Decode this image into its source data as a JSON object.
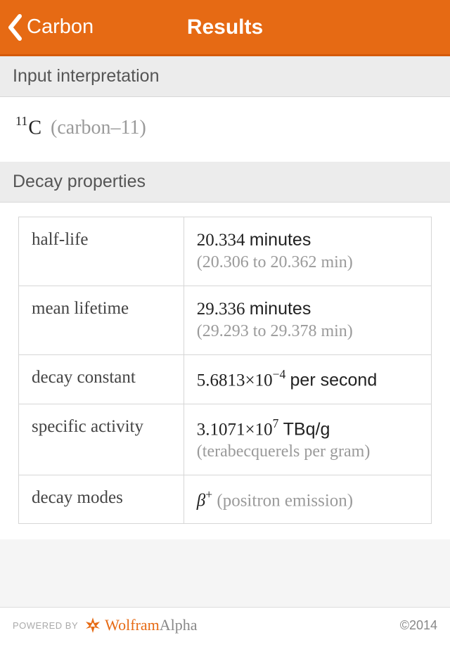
{
  "header": {
    "back_label": "Carbon",
    "title": "Results"
  },
  "sections": {
    "input": {
      "title": "Input interpretation",
      "isotope_sup": "11",
      "isotope_symbol": "C",
      "isotope_paren": "(carbon–11)"
    },
    "decay": {
      "title": "Decay properties",
      "rows": {
        "half_life": {
          "label": "half-life",
          "value_num": "20.334",
          "value_unit": "minutes",
          "sub": "(20.306 to 20.362 min)"
        },
        "mean_lifetime": {
          "label": "mean lifetime",
          "value_num": "29.336",
          "value_unit": "minutes",
          "sub": "(29.293 to 29.378 min)"
        },
        "decay_constant": {
          "label": "decay constant",
          "mantissa": "5.6813",
          "times": "×",
          "base": "10",
          "exp": "−4",
          "unit": "per second"
        },
        "specific_activity": {
          "label": "specific activity",
          "mantissa": "3.1071",
          "times": "×",
          "base": "10",
          "exp": "7",
          "unit": "TBq/g",
          "sub": "(terabecquerels per gram)"
        },
        "decay_modes": {
          "label": "decay modes",
          "symbol_base": "β",
          "symbol_sup": "+",
          "paren": "(positron emission)"
        }
      }
    }
  },
  "footer": {
    "powered": "POWERED BY",
    "wolfram": "Wolfram",
    "alpha": "Alpha",
    "copyright": "©2014"
  }
}
